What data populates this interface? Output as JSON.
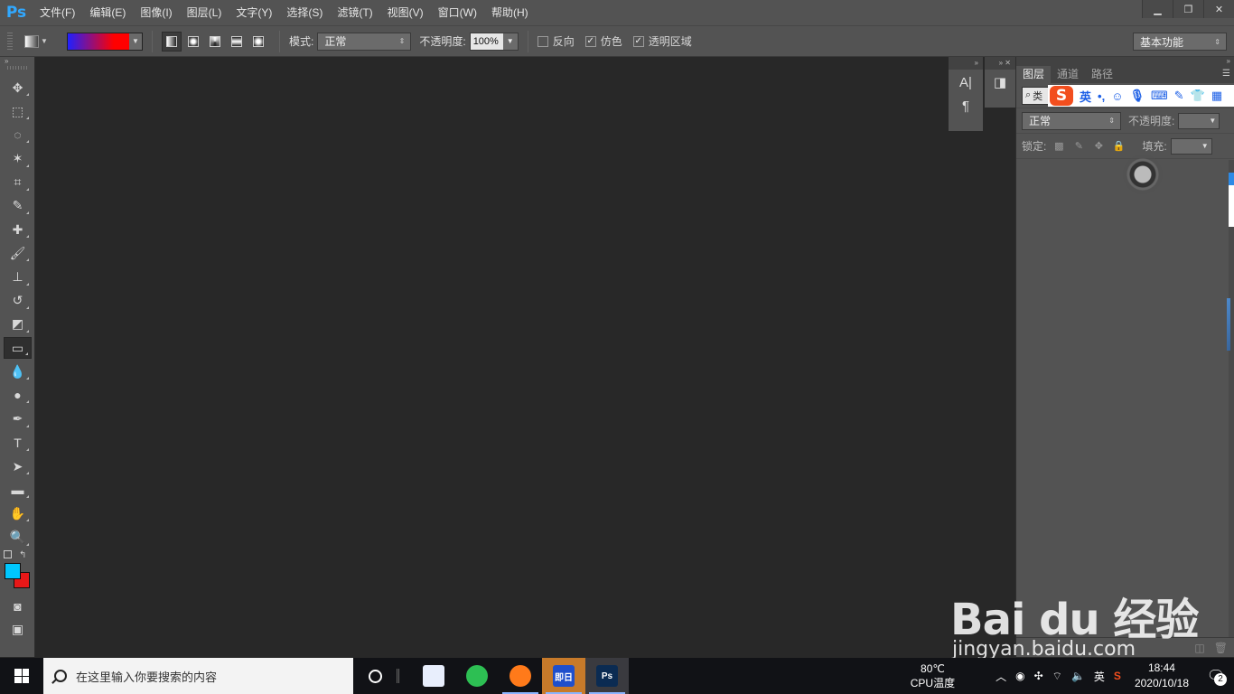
{
  "app": {
    "logo": "Ps"
  },
  "menu": [
    "文件(F)",
    "编辑(E)",
    "图像(I)",
    "图层(L)",
    "文字(Y)",
    "选择(S)",
    "滤镜(T)",
    "视图(V)",
    "窗口(W)",
    "帮助(H)"
  ],
  "window_controls": {
    "minimize": "▁",
    "restore": "❐",
    "close": "✕"
  },
  "options": {
    "gradient_colors": [
      "#2020ff",
      "#ff0000"
    ],
    "mode_label": "模式:",
    "mode_value": "正常",
    "opacity_label": "不透明度:",
    "opacity_value": "100%",
    "reverse_label": "反向",
    "reverse_checked": false,
    "dither_label": "仿色",
    "dither_checked": true,
    "transparency_label": "透明区域",
    "transparency_checked": true,
    "workspace": "基本功能"
  },
  "toolbox": {
    "tools": [
      {
        "name": "move-tool",
        "glyph": "✥"
      },
      {
        "name": "marquee-tool",
        "glyph": "⬚"
      },
      {
        "name": "lasso-tool",
        "glyph": "◌"
      },
      {
        "name": "magic-wand-tool",
        "glyph": "✶"
      },
      {
        "name": "crop-tool",
        "glyph": "⌗"
      },
      {
        "name": "eyedropper-tool",
        "glyph": "✎"
      },
      {
        "name": "healing-brush-tool",
        "glyph": "✚"
      },
      {
        "name": "brush-tool",
        "glyph": "🖌"
      },
      {
        "name": "clone-stamp-tool",
        "glyph": "⊥"
      },
      {
        "name": "history-brush-tool",
        "glyph": "↺"
      },
      {
        "name": "eraser-tool",
        "glyph": "◩"
      },
      {
        "name": "gradient-tool",
        "glyph": "▭"
      },
      {
        "name": "blur-tool",
        "glyph": "💧"
      },
      {
        "name": "dodge-tool",
        "glyph": "●"
      },
      {
        "name": "pen-tool",
        "glyph": "✒"
      },
      {
        "name": "type-tool",
        "glyph": "T"
      },
      {
        "name": "path-selection-tool",
        "glyph": "➤"
      },
      {
        "name": "rectangle-tool",
        "glyph": "▬"
      },
      {
        "name": "hand-tool",
        "glyph": "✋"
      },
      {
        "name": "zoom-tool",
        "glyph": "🔍"
      }
    ],
    "active_tool": "gradient-tool",
    "foreground_color": "#00c8ff",
    "background_color": "#e81818"
  },
  "collapsed_panels": {
    "character_icon": "A|",
    "paragraph_icon": "¶"
  },
  "layers_panel": {
    "tabs": [
      "图层",
      "通道",
      "路径"
    ],
    "active_tab": "图层",
    "search_prefix": "类",
    "ime": {
      "logo": "S",
      "lang": "英",
      "punct": "•,",
      "emoji": "☺"
    },
    "blend_mode": "正常",
    "opacity_label": "不透明度:",
    "lock_label": "锁定:",
    "fill_label": "填充:"
  },
  "watermark": {
    "brand": "Bai du 经验",
    "url": "jingyan.baidu.com"
  },
  "taskbar": {
    "search_placeholder": "在这里输入你要搜索的内容",
    "apps": [
      {
        "name": "feishu-app",
        "label": "",
        "color": "#e8eefc"
      },
      {
        "name": "wechat-app",
        "label": "",
        "color": "#2dbf53"
      },
      {
        "name": "firefox-app",
        "label": "",
        "color": "#ff7a1a"
      },
      {
        "name": "jiri-app",
        "label": "即日",
        "color": "#1f4fcc"
      },
      {
        "name": "photoshop-app",
        "label": "Ps",
        "color": "#0b2b52"
      }
    ],
    "cpu_temp": "80℃",
    "cpu_label": "CPU温度",
    "ime_lang": "英",
    "time": "18:44",
    "date": "2020/10/18",
    "notifications": "2"
  }
}
